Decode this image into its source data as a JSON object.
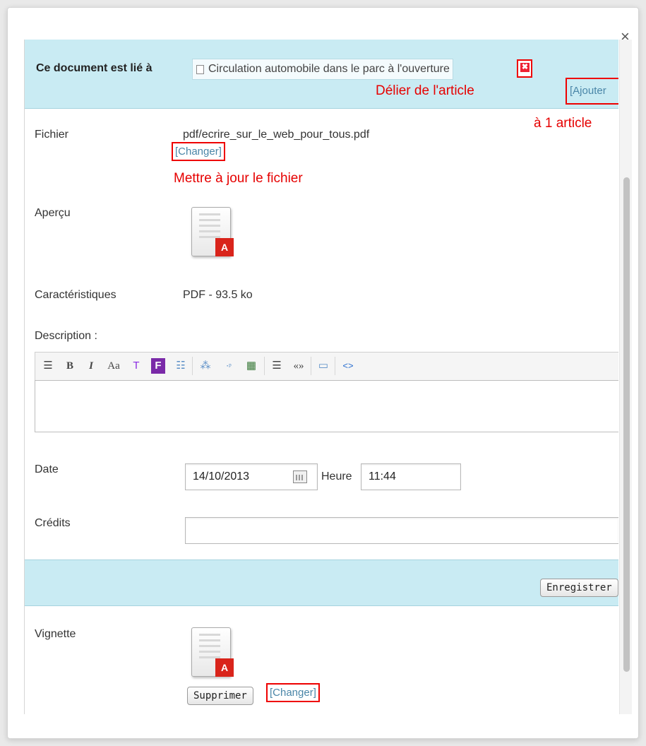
{
  "dialog": {
    "close_glyph": "×"
  },
  "links": {
    "label": "Ce document est lié à",
    "article_title": "Circulation automobile dans le parc à l'ouverture",
    "unlink_glyph": "✖",
    "ajouter_label": "[Ajouter"
  },
  "annotations": {
    "unlink": "Délier de l'article",
    "add": "à 1 article",
    "update_file": "Mettre à jour le fichier"
  },
  "fields": {
    "file_label": "Fichier",
    "file_path": "pdf/ecrire_sur_le_web_pour_tous.pdf",
    "change_label": "[Changer]",
    "preview_label": "Aperçu",
    "specs_label": "Caractéristiques",
    "specs_value": "PDF - 93.5 ko",
    "description_label": "Description :",
    "date_label": "Date",
    "date_value": "14/10/2013",
    "time_label": "Heure",
    "time_value": "11:44",
    "credits_label": "Crédits",
    "credits_value": "",
    "save_label": "Enregistrer",
    "thumbnail_label": "Vignette",
    "delete_label": "Supprimer",
    "thumb_change_label": "[Changer]"
  },
  "toolbar": {
    "buttons": [
      "☰",
      "B",
      "I",
      "Aa",
      "T",
      "F",
      "☷",
      "⁂",
      "⋅ᵖ",
      "▦",
      "☰",
      "«»",
      "▭",
      "<>"
    ]
  },
  "icons": {
    "pdf_badge": "A"
  }
}
